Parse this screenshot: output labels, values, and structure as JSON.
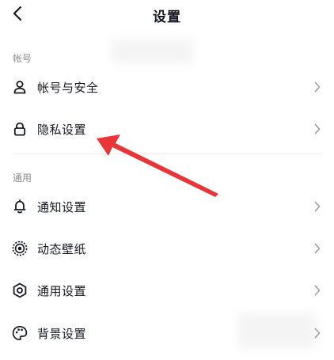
{
  "header": {
    "title": "设置",
    "back_icon": "chevron-left-icon"
  },
  "sections": [
    {
      "label": "帐号",
      "items": [
        {
          "label": "帐号与安全",
          "icon": "user-icon"
        },
        {
          "label": "隐私设置",
          "icon": "lock-icon"
        }
      ]
    },
    {
      "label": "通用",
      "items": [
        {
          "label": "通知设置",
          "icon": "bell-icon"
        },
        {
          "label": "动态壁纸",
          "icon": "radar-icon"
        },
        {
          "label": "通用设置",
          "icon": "gear-icon"
        },
        {
          "label": "背景设置",
          "icon": "palette-icon"
        }
      ]
    }
  ],
  "annotation": {
    "color": "#e8353a"
  }
}
